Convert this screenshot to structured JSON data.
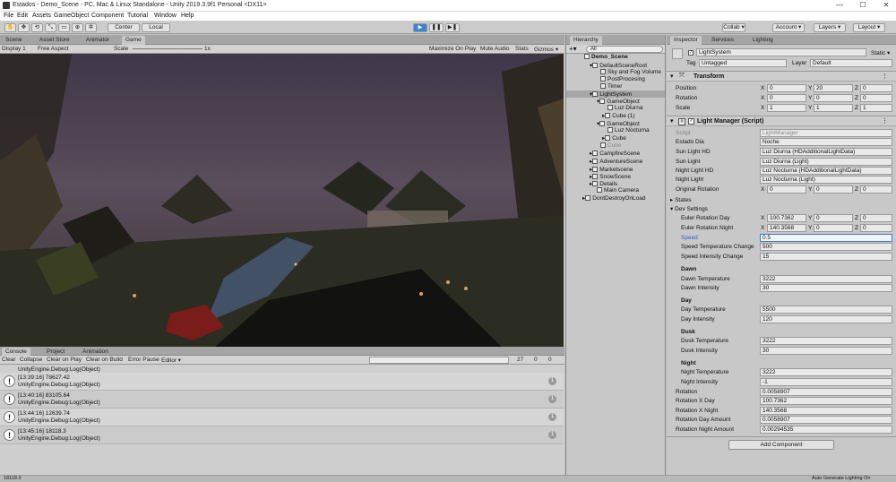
{
  "window": {
    "title": "Estados - Demo_Scene - PC, Mac & Linux Standalone - Unity 2019.3.9f1 Personal <DX11>",
    "minimize": "—",
    "maximize": "☐",
    "close": "✕"
  },
  "menu": [
    "File",
    "Edit",
    "Assets",
    "GameObject",
    "Component",
    "Tutorial",
    "Window",
    "Help"
  ],
  "toolbar": {
    "tools": [
      "✋",
      "✥",
      "⟲",
      "⤡",
      "▭",
      "⊕",
      "✲"
    ],
    "pivot": "Center",
    "space": "Local",
    "play": "▶",
    "pause": "❚❚",
    "step": "▶❚",
    "collab": "Collab ▾",
    "account": "Account ▾",
    "layers": "Layers ▾",
    "layout": "Layout ▾"
  },
  "scene_tabs": [
    "Scene",
    "Asset Store",
    "Animator",
    "Game"
  ],
  "game_bar": {
    "display": "Display 1",
    "aspect": "Free Aspect",
    "scale_label": "Scale",
    "scale_value": "1x",
    "maximize": "Maximize On Play",
    "mute": "Mute Audio",
    "stats": "Stats",
    "gizmos": "Gizmos ▾"
  },
  "console": {
    "tabs": [
      "Console",
      "Project",
      "Animation"
    ],
    "buttons": [
      "Clear",
      "Collapse",
      "Clear on Play",
      "Clear on Build",
      "Error Pause",
      "Editor ▾"
    ],
    "log_count": "27",
    "warn_count": "0",
    "error_count": "0",
    "partial_top": "UnityEngine.Debug:Log(Object)",
    "rows": [
      {
        "l1": "[13:39:16] 78627.42",
        "l2": "UnityEngine.Debug:Log(Object)",
        "count": "1"
      },
      {
        "l1": "[13:40:16] 83105.64",
        "l2": "UnityEngine.Debug:Log(Object)",
        "count": "1"
      },
      {
        "l1": "[13:44:16] 12639.74",
        "l2": "UnityEngine.Debug:Log(Object)",
        "count": "1"
      },
      {
        "l1": "[13:45:16] 18118.3",
        "l2": "UnityEngine.Debug:Log(Object)",
        "count": "1"
      }
    ],
    "status": "18118.3"
  },
  "hierarchy": {
    "tab": "Hierarchy",
    "search": "All",
    "items": [
      {
        "label": "Demo_Scene",
        "bold": true
      },
      {
        "label": "DefaultSceneRoot"
      },
      {
        "label": "Sky and Fog Volume"
      },
      {
        "label": "PostProcesing"
      },
      {
        "label": "Timer"
      },
      {
        "label": "LightSystem",
        "selected": true
      },
      {
        "label": "GameObject"
      },
      {
        "label": "Luz Diurna"
      },
      {
        "label": "Cube (1)"
      },
      {
        "label": "GameObject"
      },
      {
        "label": "Luz Nocturna"
      },
      {
        "label": "Cube"
      },
      {
        "label": "Cube"
      },
      {
        "label": "CampfireScene"
      },
      {
        "label": "AdventureScene"
      },
      {
        "label": "Marketscene"
      },
      {
        "label": "SnowScene"
      },
      {
        "label": "Details"
      },
      {
        "label": "Main Camera"
      },
      {
        "label": "DontDestroyOnLoad"
      }
    ]
  },
  "inspector": {
    "tabs": [
      "Inspector",
      "Services",
      "Lighting"
    ],
    "object_name": "LightSystem",
    "static": "Static ▾",
    "tag_label": "Tag",
    "tag": "Untagged",
    "layer_label": "Layer",
    "layer": "Default",
    "transform": {
      "title": "Transform",
      "rows": [
        {
          "label": "Position",
          "x": "0",
          "y": "20",
          "z": "0"
        },
        {
          "label": "Rotation",
          "x": "0",
          "y": "0",
          "z": "0"
        },
        {
          "label": "Scale",
          "x": "1",
          "y": "1",
          "z": "1"
        }
      ]
    },
    "light_manager": {
      "title": "Light Manager (Script)",
      "script_label": "Script",
      "script": "LightManager",
      "fields": [
        {
          "label": "Estado Dia",
          "value": "Noche"
        },
        {
          "label": "Sun Light HD",
          "value": "Luz Diurna (HDAdditionalLightData)"
        },
        {
          "label": "Sun Light",
          "value": "Luz Diurna (Light)"
        },
        {
          "label": "Night Light HD",
          "value": "Luz Nocturna (HDAdditionalLightData)"
        },
        {
          "label": "Night Light",
          "value": "Luz Nocturna (Light)"
        }
      ],
      "original_rotation": {
        "label": "Original Rotation",
        "x": "0",
        "y": "0",
        "z": "0"
      },
      "states": "States",
      "dev_settings": "Dev Settings",
      "euler_day": {
        "label": "Euler Rotation Day",
        "x": "100.7362",
        "y": "0",
        "z": "0"
      },
      "euler_night": {
        "label": "Euler Rotation Night",
        "x": "140.3568",
        "y": "0",
        "z": "0"
      },
      "speed": {
        "label": "Speed",
        "value": "0.5"
      },
      "speed_temp": {
        "label": "Speed Temperature Change",
        "value": "500"
      },
      "speed_int": {
        "label": "Speed Intensity Change",
        "value": "15"
      },
      "groups": [
        {
          "title": "Dawn",
          "temp_label": "Dawn Temperature",
          "temp": "3222",
          "int_label": "Dawn Intensity",
          "int": "30"
        },
        {
          "title": "Day",
          "temp_label": "Day Temperature",
          "temp": "5500",
          "int_label": "Day Intensity",
          "int": "120"
        },
        {
          "title": "Dusk",
          "temp_label": "Dusk Temperature",
          "temp": "3222",
          "int_label": "Dusk Intensity",
          "int": "30"
        },
        {
          "title": "Night",
          "temp_label": "Night Temperature",
          "temp": "3222",
          "int_label": "Night Intensity",
          "int": "-1"
        }
      ],
      "readouts": [
        {
          "label": "Rotation",
          "value": "0.0058907"
        },
        {
          "label": "Rotation X Day",
          "value": "100.7362"
        },
        {
          "label": "Rotation X Night",
          "value": "140.3568"
        },
        {
          "label": "Rotation Day Amount",
          "value": "0.0058907"
        },
        {
          "label": "Rotation Night Amount",
          "value": "0.00294535"
        }
      ]
    },
    "add_component": "Add Component"
  },
  "status_right": "Auto Generate Lighting On"
}
